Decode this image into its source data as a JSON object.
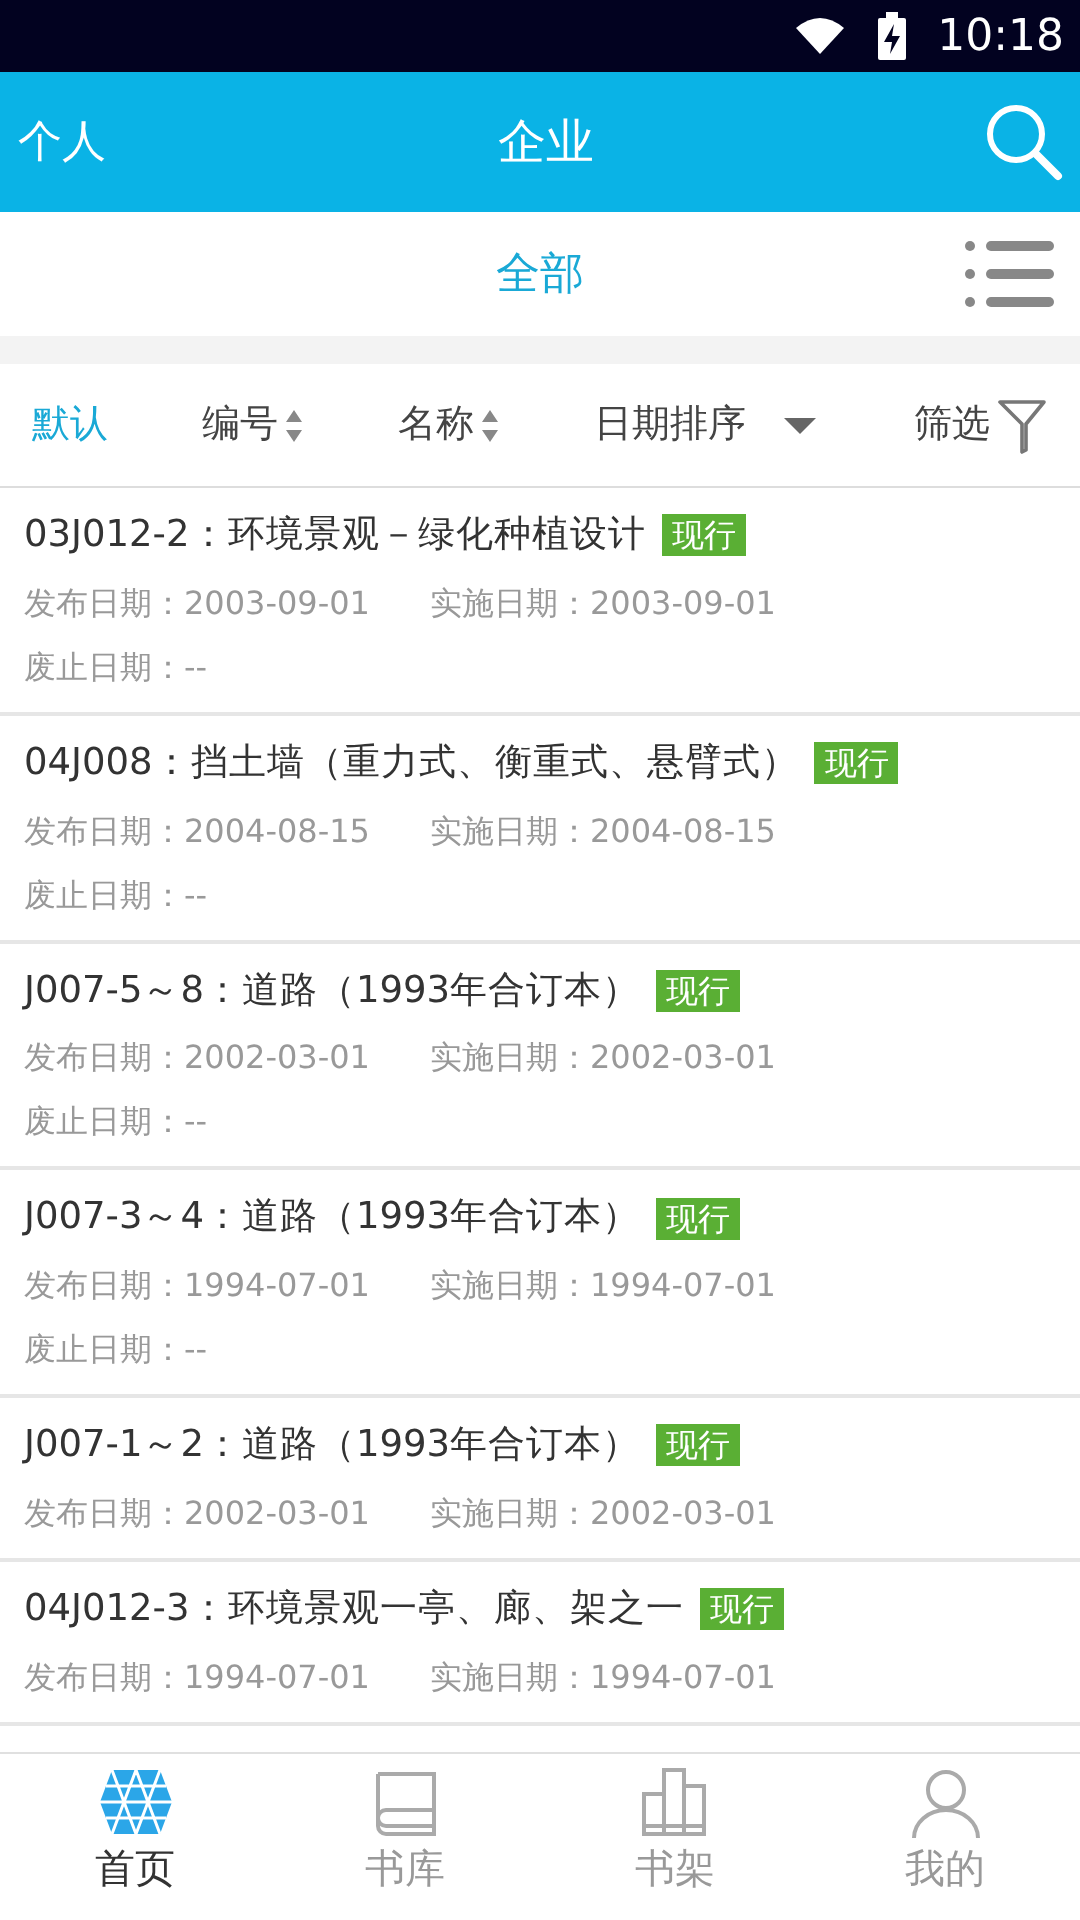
{
  "status_bar": {
    "time": "10:18"
  },
  "app_bar": {
    "left": "个人",
    "title": "企业"
  },
  "category": {
    "label": "全部"
  },
  "sort_bar": [
    {
      "label": "默认",
      "selected": true,
      "kind": "plain"
    },
    {
      "label": "编号",
      "selected": false,
      "kind": "sort"
    },
    {
      "label": "名称",
      "selected": false,
      "kind": "sort"
    },
    {
      "label": "日期排序",
      "selected": false,
      "kind": "dropdown"
    },
    {
      "label": "筛选",
      "selected": false,
      "kind": "filter"
    }
  ],
  "items": [
    {
      "title": "03J012-2：环境景观－绿化种植设计",
      "status": "现行",
      "color": "#5aaf34",
      "published": "发布日期：2003-09-01",
      "effective": "实施日期：2003-09-01",
      "abolished": "废止日期：--"
    },
    {
      "title": "04J008：挡土墙（重力式、衡重式、悬臂式）",
      "status": "现行",
      "color": "#5aaf34",
      "published": "发布日期：2004-08-15",
      "effective": "实施日期：2004-08-15",
      "abolished": "废止日期：--"
    },
    {
      "title": "J007-5～8：道路（1993年合订本）",
      "status": "现行",
      "color": "#5aaf34",
      "published": "发布日期：2002-03-01",
      "effective": "实施日期：2002-03-01",
      "abolished": "废止日期：--"
    },
    {
      "title": "J007-3～4：道路（1993年合订本）",
      "status": "现行",
      "color": "#5aaf34",
      "published": "发布日期：1994-07-01",
      "effective": "实施日期：1994-07-01",
      "abolished": "废止日期：--"
    },
    {
      "title": "J007-1～2：道路（1993年合订本）",
      "status": "现行",
      "color": "#5aaf34",
      "published": "发布日期：2002-03-01",
      "effective": "实施日期：2002-03-01"
    },
    {
      "title": "04J012-3：环境景观一亭、廊、架之一",
      "status": "现行",
      "color": "#5aaf34",
      "published": "发布日期：1994-07-01",
      "effective": "实施日期：1994-07-01"
    }
  ],
  "tab_bar": [
    {
      "label": "首页",
      "selected": true,
      "kind": "home"
    },
    {
      "label": "书库",
      "selected": false,
      "kind": "library"
    },
    {
      "label": "书架",
      "selected": false,
      "kind": "shelf"
    },
    {
      "label": "我的",
      "selected": false,
      "kind": "profile"
    }
  ]
}
